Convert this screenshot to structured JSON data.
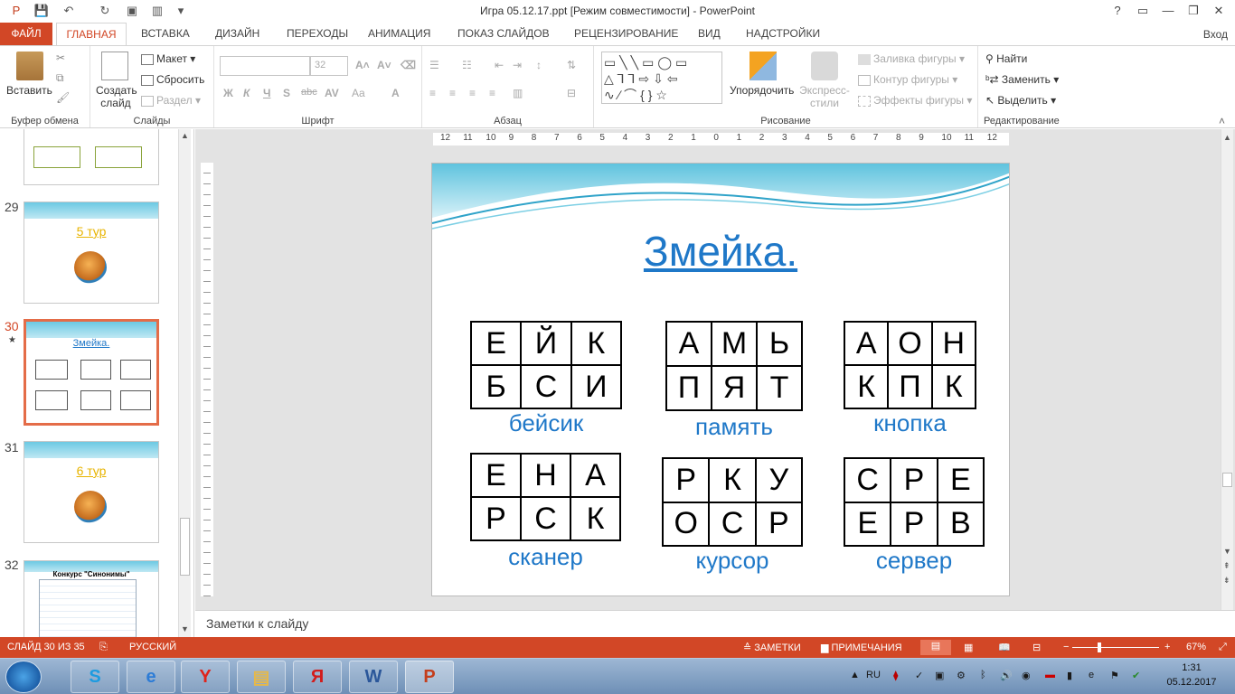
{
  "titlebar": {
    "title": "Игра 05.12.17.ppt [Режим совместимости] - PowerPoint",
    "help": "?",
    "minimize": "—",
    "restore": "❐",
    "close": "✕"
  },
  "tabs": [
    "ФАЙЛ",
    "ГЛАВНАЯ",
    "ВСТАВКА",
    "ДИЗАЙН",
    "ПЕРЕХОДЫ",
    "АНИМАЦИЯ",
    "ПОКАЗ СЛАЙДОВ",
    "РЕЦЕНЗИРОВАНИЕ",
    "ВИД",
    "НАДСТРОЙКИ"
  ],
  "signin": "Вход",
  "ribbon": {
    "clipboard": {
      "label": "Буфер обмена",
      "paste": "Вставить"
    },
    "slides": {
      "label": "Слайды",
      "new_slide": "Создать слайд",
      "layout": "Макет",
      "reset": "Сбросить",
      "section": "Раздел"
    },
    "font": {
      "label": "Шрифт",
      "size": "32"
    },
    "paragraph": {
      "label": "Абзац"
    },
    "drawing": {
      "label": "Рисование",
      "arrange": "Упорядочить",
      "quick_styles": "Экспресс-стили",
      "fill": "Заливка фигуры",
      "outline": "Контур фигуры",
      "effects": "Эффекты фигуры"
    },
    "editing": {
      "label": "Редактирование",
      "find": "Найти",
      "replace": "Заменить",
      "select": "Выделить"
    }
  },
  "thumbs": [
    {
      "num": "29",
      "title": "5 тур"
    },
    {
      "num": "30",
      "title": "Змейка."
    },
    {
      "num": "31",
      "title": "6 тур"
    },
    {
      "num": "32",
      "title": "Конкурс \"Синонимы\""
    }
  ],
  "ruler_ticks": [
    "12",
    "11",
    "10",
    "9",
    "8",
    "7",
    "6",
    "5",
    "4",
    "3",
    "2",
    "1",
    "0",
    "1",
    "2",
    "3",
    "4",
    "5",
    "6",
    "7",
    "8",
    "9",
    "10",
    "11",
    "12"
  ],
  "slide": {
    "title": "Змейка.",
    "puzzles": [
      {
        "rows": [
          [
            "Е",
            "Й",
            "К"
          ],
          [
            "Б",
            "С",
            "И"
          ]
        ],
        "word": "бейсик"
      },
      {
        "rows": [
          [
            "А",
            "М",
            "Ь"
          ],
          [
            "П",
            "Я",
            "Т"
          ]
        ],
        "word": "память"
      },
      {
        "rows": [
          [
            "А",
            "О",
            "Н"
          ],
          [
            "К",
            "П",
            "К"
          ]
        ],
        "word": "кнопка"
      },
      {
        "rows": [
          [
            "Е",
            "Н",
            "А"
          ],
          [
            "Р",
            "С",
            "К"
          ]
        ],
        "word": "сканер"
      },
      {
        "rows": [
          [
            "Р",
            "К",
            "У"
          ],
          [
            "О",
            "С",
            "Р"
          ]
        ],
        "word": "курсор"
      },
      {
        "rows": [
          [
            "С",
            "Р",
            "Е"
          ],
          [
            "Е",
            "Р",
            "В"
          ]
        ],
        "word": "сервер"
      }
    ]
  },
  "notes_placeholder": "Заметки к слайду",
  "status": {
    "slide_counter": "СЛАЙД 30 ИЗ 35",
    "language": "РУССКИЙ",
    "notes": "ЗАМЕТКИ",
    "comments": "ПРИМЕЧАНИЯ",
    "zoom": "67%"
  },
  "taskbar": {
    "lang": "RU",
    "time": "1:31",
    "date": "05.12.2017"
  },
  "colors": {
    "accent": "#d24726",
    "title_blue": "#1f78c8"
  }
}
